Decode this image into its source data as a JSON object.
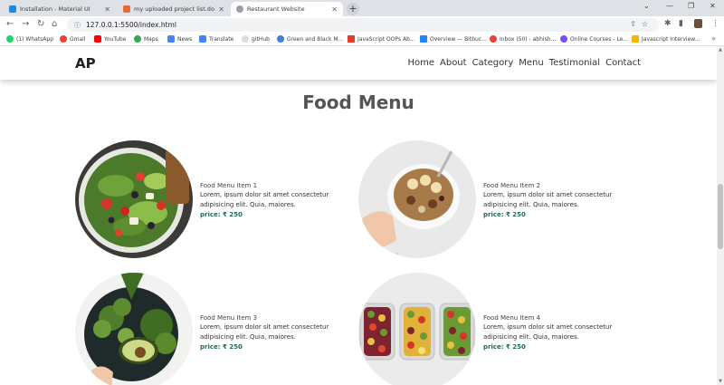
{
  "browser": {
    "tabs": [
      {
        "title": "Installation - Material UI",
        "active": false
      },
      {
        "title": "my uploaded project list.downlo",
        "active": false
      },
      {
        "title": "Restaurant Website",
        "active": true
      }
    ],
    "new_tab": "+",
    "url": "127.0.0.1:5500/index.html",
    "bookmarks": [
      {
        "label": "(1) WhatsApp",
        "color": "#25d366"
      },
      {
        "label": "Gmail",
        "color": "#ea4335"
      },
      {
        "label": "YouTube",
        "color": "#ff0000"
      },
      {
        "label": "Maps",
        "color": "#34a853"
      },
      {
        "label": "News",
        "color": "#4285f4"
      },
      {
        "label": "Translate",
        "color": "#4285f4"
      },
      {
        "label": "gitHub",
        "color": "#24292e"
      },
      {
        "label": "Green and Black M...",
        "color": "#3f7fd8"
      },
      {
        "label": "JavaScript OOPs Ab...",
        "color": "#e33b2e"
      },
      {
        "label": "Overview — Bitbuc...",
        "color": "#2684ff"
      },
      {
        "label": "Inbox (50) - abhish...",
        "color": "#ea4335"
      },
      {
        "label": "Online Courses - Le...",
        "color": "#7c4dff"
      },
      {
        "label": "Javascript Interview...",
        "color": "#f7b500"
      }
    ]
  },
  "site": {
    "logo": "AP",
    "nav": [
      "Home",
      "About",
      "Category",
      "Menu",
      "Testimonial",
      "Contact"
    ]
  },
  "menu": {
    "title": "Food Menu",
    "items": [
      {
        "name": "Food Menu Item 1",
        "desc": "Lorem, ipsum dolor sit amet consectetur adipisicing elit. Quia, maiores.",
        "price": "price: ₹ 250",
        "image": "green-salad-plate"
      },
      {
        "name": "Food Menu Item 2",
        "desc": "Lorem, ipsum dolor sit amet consectetur adipisicing elit. Quia, maiores.",
        "price": "price: ₹ 250",
        "image": "granola-banana-bowl"
      },
      {
        "name": "Food Menu Item 3",
        "desc": "Lorem, ipsum dolor sit amet consectetur adipisicing elit. Quia, maiores.",
        "price": "price: ₹ 250",
        "image": "broccoli-avocado-bowl"
      },
      {
        "name": "Food Menu Item 4",
        "desc": "Lorem, ipsum dolor sit amet consectetur adipisicing elit. Quia, maiores.",
        "price": "price: ₹ 250",
        "image": "meal-prep-containers"
      }
    ]
  },
  "colors": {
    "price": "#1f6e4a",
    "title": "#555555",
    "tabbar": "#dee1e6"
  }
}
